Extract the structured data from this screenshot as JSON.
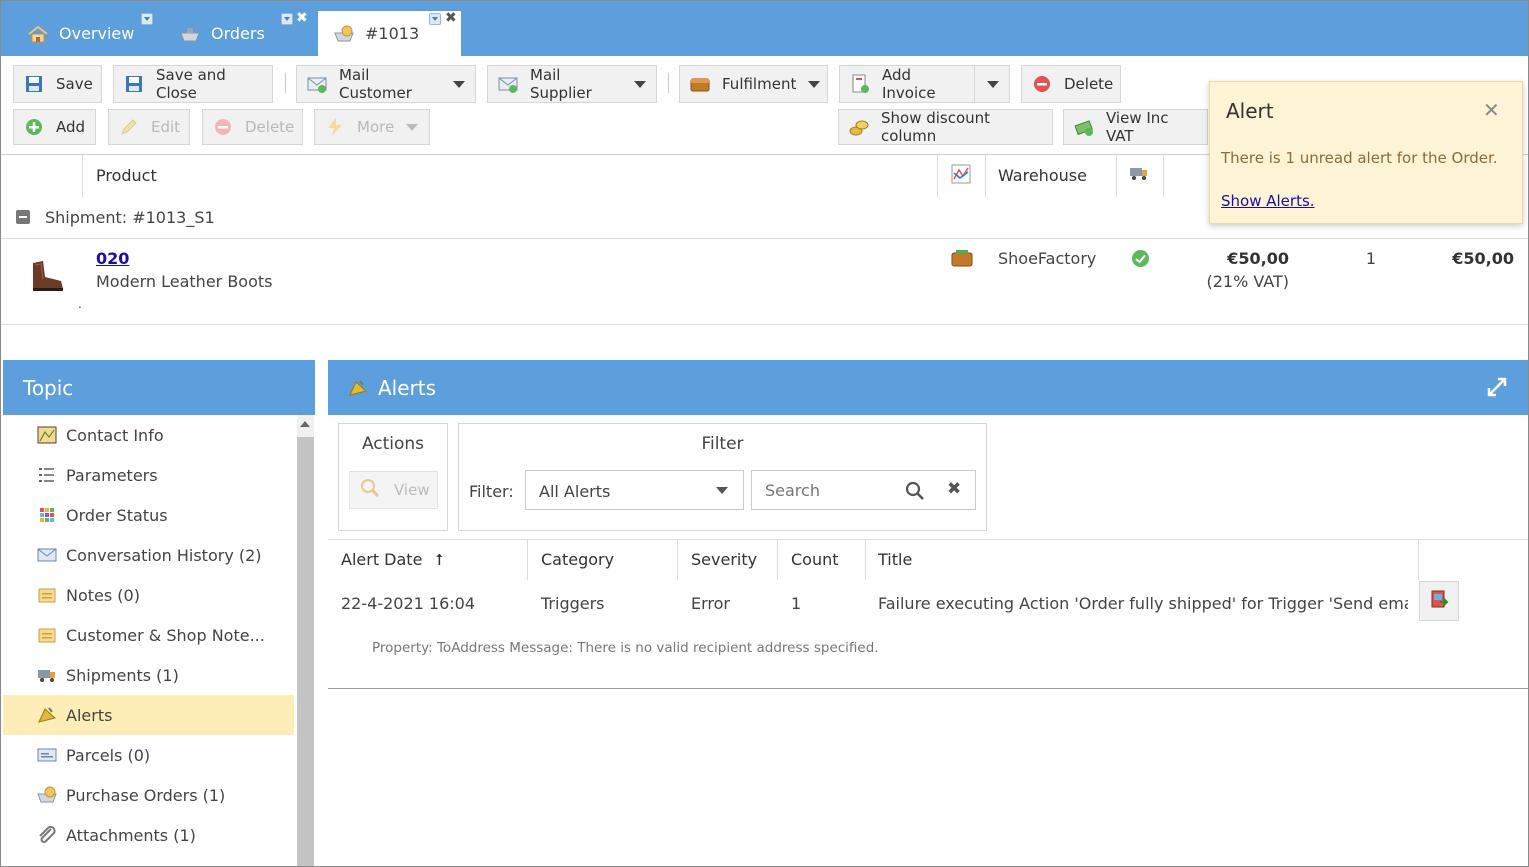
{
  "tabs": [
    {
      "label": "Overview",
      "icon": "home-icon"
    },
    {
      "label": "Orders",
      "icon": "orders-icon"
    },
    {
      "label": "#1013",
      "icon": "order-icon"
    }
  ],
  "toolbar": {
    "save": "Save",
    "save_close": "Save and Close",
    "mail_customer": "Mail Customer",
    "mail_supplier": "Mail Supplier",
    "fulfilment": "Fulfilment",
    "add_invoice": "Add Invoice",
    "delete": "Delete",
    "add": "Add",
    "edit": "Edit",
    "delete_row": "Delete",
    "more": "More",
    "show_discount": "Show discount column",
    "view_inc_vat": "View Inc VAT"
  },
  "order_grid": {
    "columns": {
      "product": "Product",
      "warehouse": "Warehouse"
    },
    "shipment_label": "Shipment: #1013_S1",
    "row": {
      "code": "020",
      "name": "Modern Leather Boots",
      "dot": ".",
      "warehouse": "ShoeFactory",
      "price": "€50,00",
      "vat": "(21% VAT)",
      "qty": "1",
      "total": "€50,00"
    }
  },
  "alert_popup": {
    "title": "Alert",
    "message": "There is 1 unread alert for the Order.",
    "link": "Show Alerts."
  },
  "topic": {
    "title": "Topic",
    "items": [
      {
        "label": "Contact Info",
        "icon": "contact-card-icon"
      },
      {
        "label": "Parameters",
        "icon": "list-icon"
      },
      {
        "label": "Order Status",
        "icon": "grid-icon"
      },
      {
        "label": "Conversation History (2)",
        "icon": "envelope-icon"
      },
      {
        "label": "Notes (0)",
        "icon": "note-icon"
      },
      {
        "label": "Customer & Shop Note...",
        "icon": "note-icon"
      },
      {
        "label": "Shipments (1)",
        "icon": "truck-icon"
      },
      {
        "label": "Alerts",
        "icon": "alert-icon"
      },
      {
        "label": "Parcels (0)",
        "icon": "parcel-icon"
      },
      {
        "label": "Purchase Orders (1)",
        "icon": "purchase-order-icon"
      },
      {
        "label": "Attachments (1)",
        "icon": "paperclip-icon"
      }
    ]
  },
  "alerts_panel": {
    "title": "Alerts",
    "actions_label": "Actions",
    "view_label": "View",
    "filter_title": "Filter",
    "filter_label": "Filter:",
    "filter_value": "All Alerts",
    "search_placeholder": "Search",
    "columns": {
      "date": "Alert Date",
      "category": "Category",
      "severity": "Severity",
      "count": "Count",
      "title": "Title"
    },
    "row": {
      "date": "22-4-2021 16:04",
      "category": "Triggers",
      "severity": "Error",
      "count": "1",
      "title": "Failure executing Action 'Order fully shipped' for Trigger 'Send email', O...",
      "detail": "Property: ToAddress Message: There is no valid recipient address specified."
    }
  }
}
